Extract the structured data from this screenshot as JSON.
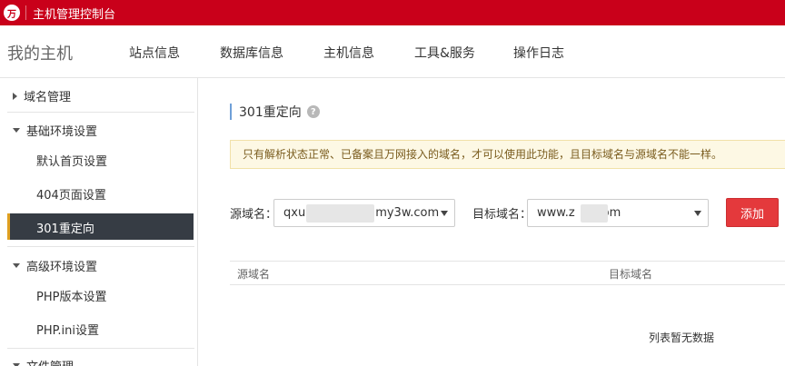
{
  "app": {
    "logo_text": "万",
    "title": "主机管理控制台"
  },
  "navbar": {
    "brand": "我的主机",
    "items": [
      "站点信息",
      "数据库信息",
      "主机信息",
      "工具&服务",
      "操作日志"
    ]
  },
  "sidebar": {
    "domain_mgmt": "域名管理",
    "basic_env": "基础环境设置",
    "basic_items": [
      "默认首页设置",
      "404页面设置",
      "301重定向"
    ],
    "active_item": "301重定向",
    "advanced_env": "高级环境设置",
    "advanced_items": [
      "PHP版本设置",
      "PHP.ini设置"
    ],
    "file_mgmt": "文件管理"
  },
  "main": {
    "title": "301重定向",
    "help_icon": "?",
    "notice": "只有解析状态正常、已备案且万网接入的域名，才可以使用此功能，且目标域名与源域名不能一样。",
    "source_label": "源域名：",
    "source_value_prefix": "qxu",
    "source_value_suffix": "my3w.com",
    "target_label": "目标域名：",
    "target_value_prefix": "www.z",
    "target_value_suffix": "om",
    "add_button": "添加",
    "table_headers": [
      "源域名",
      "目标域名"
    ],
    "empty_text": "列表暂无数据"
  },
  "colors": {
    "topbar": "#c9001a",
    "add_button": "#e4393c",
    "active_bg": "#363c44",
    "notice_bg": "#fdf8e4"
  }
}
